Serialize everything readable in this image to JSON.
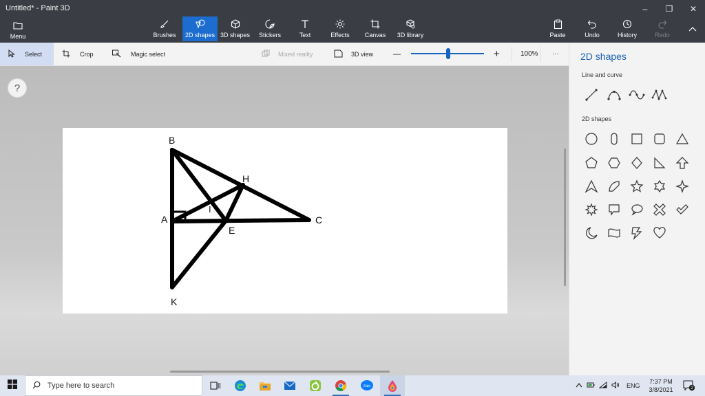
{
  "window": {
    "title": "Untitled* - Paint 3D",
    "minimize": "–",
    "maximize": "❐",
    "close": "✕"
  },
  "ribbon": {
    "menu": "Menu",
    "tools": [
      {
        "label": "Brushes",
        "icon": "brush-icon"
      },
      {
        "label": "2D shapes",
        "icon": "2d-shapes-icon",
        "active": true
      },
      {
        "label": "3D shapes",
        "icon": "cube-icon"
      },
      {
        "label": "Stickers",
        "icon": "sticker-icon"
      },
      {
        "label": "Text",
        "icon": "text-icon"
      },
      {
        "label": "Effects",
        "icon": "effects-icon"
      },
      {
        "label": "Canvas",
        "icon": "canvas-icon"
      },
      {
        "label": "3D library",
        "icon": "3d-library-icon"
      }
    ],
    "actions": [
      {
        "label": "Paste",
        "icon": "paste-icon"
      },
      {
        "label": "Undo",
        "icon": "undo-icon"
      },
      {
        "label": "History",
        "icon": "history-icon"
      },
      {
        "label": "Redo",
        "icon": "redo-icon",
        "disabled": true
      }
    ]
  },
  "subbar": {
    "select": "Select",
    "crop": "Crop",
    "magic_select": "Magic select",
    "mixed_reality": "Mixed reality",
    "view_3d": "3D view",
    "zoom": "100%",
    "zoom_minus": "—",
    "zoom_plus": "+",
    "more": "···"
  },
  "help": "?",
  "drawing": {
    "points": {
      "B": {
        "label": "B"
      },
      "H": {
        "label": "H"
      },
      "I": {
        "label": "I"
      },
      "A": {
        "label": "A"
      },
      "E": {
        "label": "E"
      },
      "C": {
        "label": "C"
      },
      "K": {
        "label": "K"
      }
    }
  },
  "panel": {
    "title": "2D shapes",
    "section_lines": "Line and curve",
    "section_shapes": "2D shapes",
    "line_tools": [
      "line-icon",
      "curve-icon",
      "wave-curve-icon",
      "polyline-icon"
    ],
    "shapes": [
      "circle-icon",
      "capsule-icon",
      "square-icon",
      "rounded-square-icon",
      "triangle-icon",
      "pentagon-icon",
      "hexagon-icon",
      "diamond-icon",
      "right-triangle-icon",
      "arrow-up-icon",
      "arrowhead-icon",
      "quarter-circle-icon",
      "star5-icon",
      "star6-icon",
      "star4-icon",
      "burst-icon",
      "speech-rect-icon",
      "speech-oval-icon",
      "cross-icon",
      "check-icon",
      "moon-icon",
      "banner-icon",
      "lightning-icon",
      "heart-icon"
    ]
  },
  "taskbar": {
    "search_placeholder": "Type here to search",
    "time": "7:37 PM",
    "date": "3/8/2021",
    "lang": "ENG",
    "notifications": "2",
    "apps": [
      "task-view-icon",
      "edge-icon",
      "file-explorer-icon",
      "mail-icon",
      "app-green-icon",
      "chrome-icon",
      "zalo-icon",
      "paint3d-icon"
    ],
    "zalo_text": "Zalo"
  },
  "colors": {
    "accent": "#1d6ccf",
    "ribbon": "#3a3e44",
    "panel_title": "#1b5fb5"
  }
}
